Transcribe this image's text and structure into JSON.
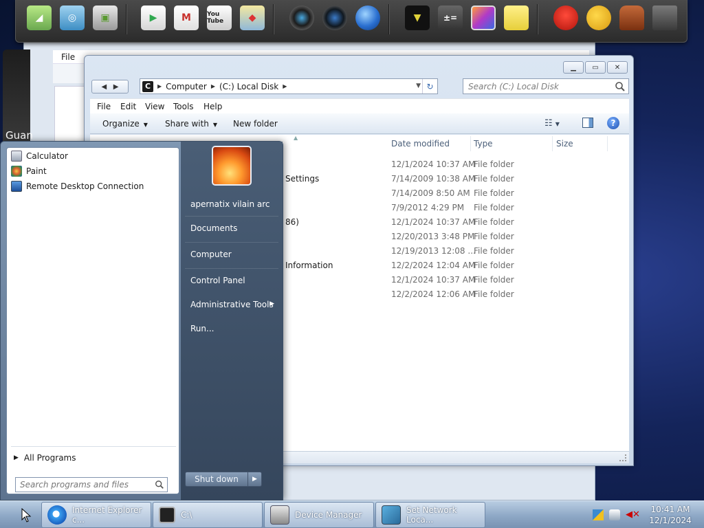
{
  "dock": {
    "icons": [
      "android-icon",
      "android-network-icon",
      "android-folder-icon",
      "play-store-icon",
      "gmail-icon",
      "youtube-icon",
      "maps-icon",
      "camera-lens-icon",
      "speaker-icon",
      "globe-icon",
      "palette-icon",
      "calculator-icon",
      "picture-frame-icon",
      "sticky-note-icon",
      "angry-bird-icon",
      "weather-icon",
      "gingerbread-icon",
      "trash-icon"
    ],
    "youtube_label": "You Tube"
  },
  "background_window": {
    "menu_label": "File",
    "left_label": "Guan"
  },
  "explorer": {
    "window_buttons": [
      "minimize-button",
      "maximize-button",
      "close-button"
    ],
    "address": {
      "drive_glyph": "C",
      "crumbs": [
        "Computer",
        "(C:) Local Disk"
      ]
    },
    "search_placeholder": "Search (C:) Local Disk",
    "menu": [
      "File",
      "Edit",
      "View",
      "Tools",
      "Help"
    ],
    "toolbar": {
      "organize": "Organize",
      "share_with": "Share with",
      "new_folder": "New folder"
    },
    "columns": [
      "Date modified",
      "Type",
      "Size"
    ],
    "rows": [
      {
        "name": "",
        "date": "12/1/2024 10:37 AM",
        "type": "File folder"
      },
      {
        "name": "Settings",
        "date": "7/14/2009 10:38 AM",
        "type": "File folder"
      },
      {
        "name": "",
        "date": "7/14/2009 8:50 AM",
        "type": "File folder"
      },
      {
        "name": "",
        "date": "7/9/2012 4:29 PM",
        "type": "File folder"
      },
      {
        "name": "86)",
        "date": "12/1/2024 10:37 AM",
        "type": "File folder"
      },
      {
        "name": "",
        "date": "12/20/2013 3:48 PM",
        "type": "File folder"
      },
      {
        "name": "",
        "date": "12/19/2013 12:08 ...",
        "type": "File folder"
      },
      {
        "name": "Information",
        "date": "12/2/2024 12:04 AM",
        "type": "File folder"
      },
      {
        "name": "",
        "date": "12/1/2024 10:37 AM",
        "type": "File folder"
      },
      {
        "name": "",
        "date": "12/2/2024 12:06 AM",
        "type": "File folder"
      }
    ]
  },
  "start_menu": {
    "programs": [
      {
        "label": "Calculator",
        "icon": "calculator-icon"
      },
      {
        "label": "Paint",
        "icon": "paint-icon"
      },
      {
        "label": "Remote Desktop Connection",
        "icon": "remote-desktop-icon"
      }
    ],
    "all_programs": "All Programs",
    "search_placeholder": "Search programs and files",
    "user_name": "apernatix vilain arc",
    "right_items": [
      "Documents",
      "Computer",
      "Control Panel",
      "Administrative Tools",
      "Run..."
    ],
    "shutdown_label": "Shut down"
  },
  "taskbar": {
    "tasks": [
      {
        "label": "Internet Explorer c...",
        "icon": "internet-explorer-icon"
      },
      {
        "label": "C:\\",
        "icon": "drive-icon"
      },
      {
        "label": "Device Manager",
        "icon": "device-manager-icon"
      },
      {
        "label": "Set Network Loca...",
        "icon": "network-icon"
      }
    ],
    "tray_icons": [
      "flag-icon",
      "network-tray-icon",
      "volume-muted-icon"
    ],
    "clock": {
      "time": "10:41 AM",
      "date": "12/1/2024"
    }
  }
}
